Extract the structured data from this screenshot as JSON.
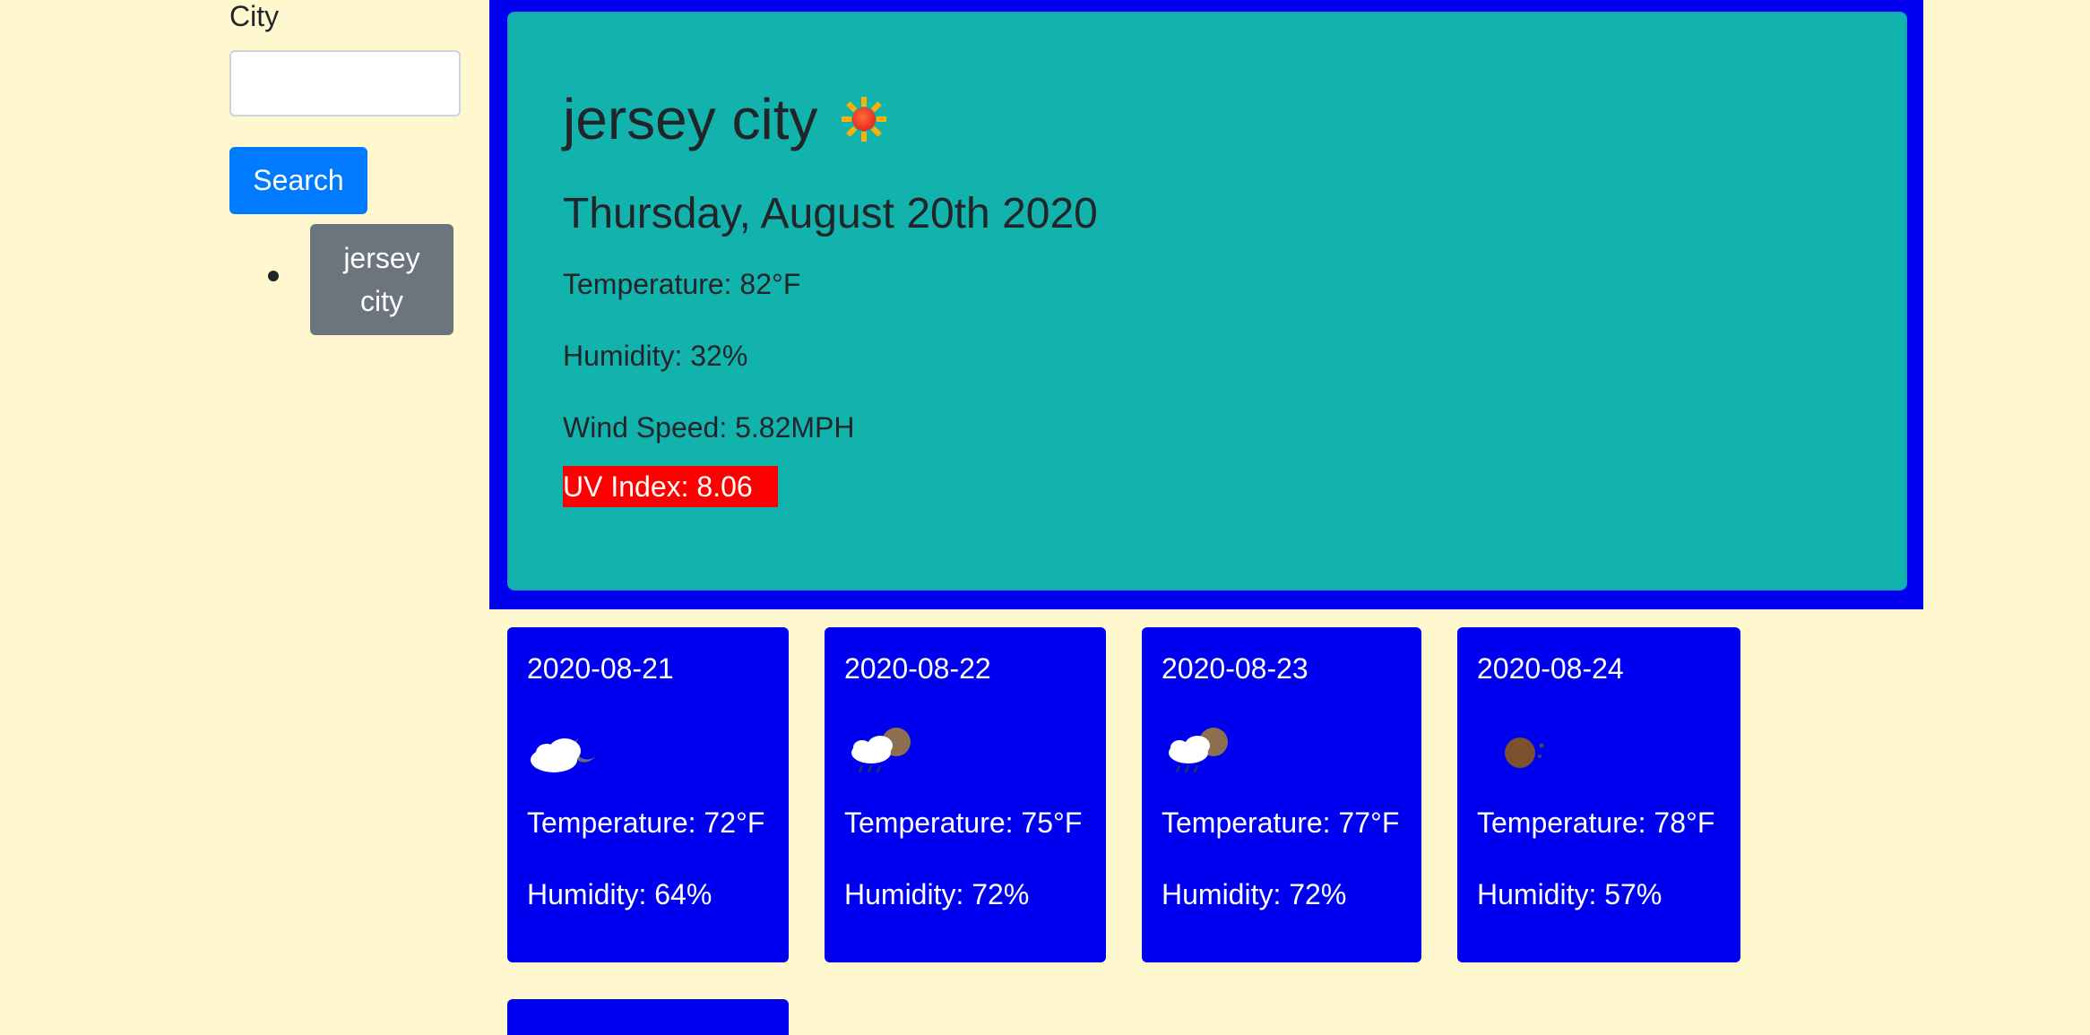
{
  "sidebar": {
    "city_label": "City",
    "city_input_value": "",
    "search_label": "Search",
    "history": [
      "jersey\ncity"
    ]
  },
  "current": {
    "city": "jersey city",
    "icon": "sun-icon",
    "date": "Thursday, August 20th 2020",
    "temperature": "Temperature: 82°F",
    "humidity": "Humidity: 32%",
    "wind": "Wind Speed: 5.82MPH",
    "uv": "UV Index: 8.06",
    "uv_color": "#ff0000"
  },
  "forecast": [
    {
      "date": "2020-08-21",
      "icon": "cloudy-night-icon",
      "temperature": "Temperature: 72°F",
      "humidity": "Humidity: 64%"
    },
    {
      "date": "2020-08-22",
      "icon": "rain-night-icon",
      "temperature": "Temperature: 75°F",
      "humidity": "Humidity: 72%"
    },
    {
      "date": "2020-08-23",
      "icon": "rain-night-icon",
      "temperature": "Temperature: 77°F",
      "humidity": "Humidity: 72%"
    },
    {
      "date": "2020-08-24",
      "icon": "clear-night-icon",
      "temperature": "Temperature: 78°F",
      "humidity": "Humidity: 57%"
    }
  ],
  "colors": {
    "page_background": "#fff8cf",
    "current_border": "#0000f0",
    "current_card": "#13b3ad",
    "forecast_card": "#0000f0",
    "search_button": "#007bff",
    "history_button": "#6c757d"
  }
}
